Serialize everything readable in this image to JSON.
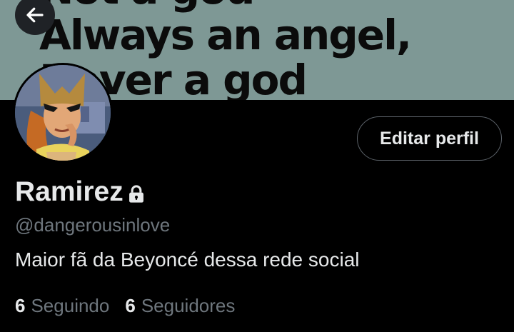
{
  "banner": {
    "lines": [
      "Not a god",
      "Always an angel,",
      "Never a god"
    ],
    "background_color": "#7e9895"
  },
  "header": {
    "back_icon": "arrow-left-icon"
  },
  "profile": {
    "avatar_icon": "hawkgirl-cartoon-avatar",
    "edit_button_label": "Editar perfil",
    "name": "Ramirez",
    "protected_icon": "lock-icon",
    "handle": "@dangerousinlove",
    "bio": "Maior fã da Beyoncé dessa rede social"
  },
  "stats": {
    "following_count": "6",
    "following_label": "Seguindo",
    "followers_count": "6",
    "followers_label": "Seguidores"
  },
  "colors": {
    "background": "#000000",
    "text_primary": "#e7e9ea",
    "text_secondary": "#6e767d",
    "button_border": "#5b6168"
  }
}
